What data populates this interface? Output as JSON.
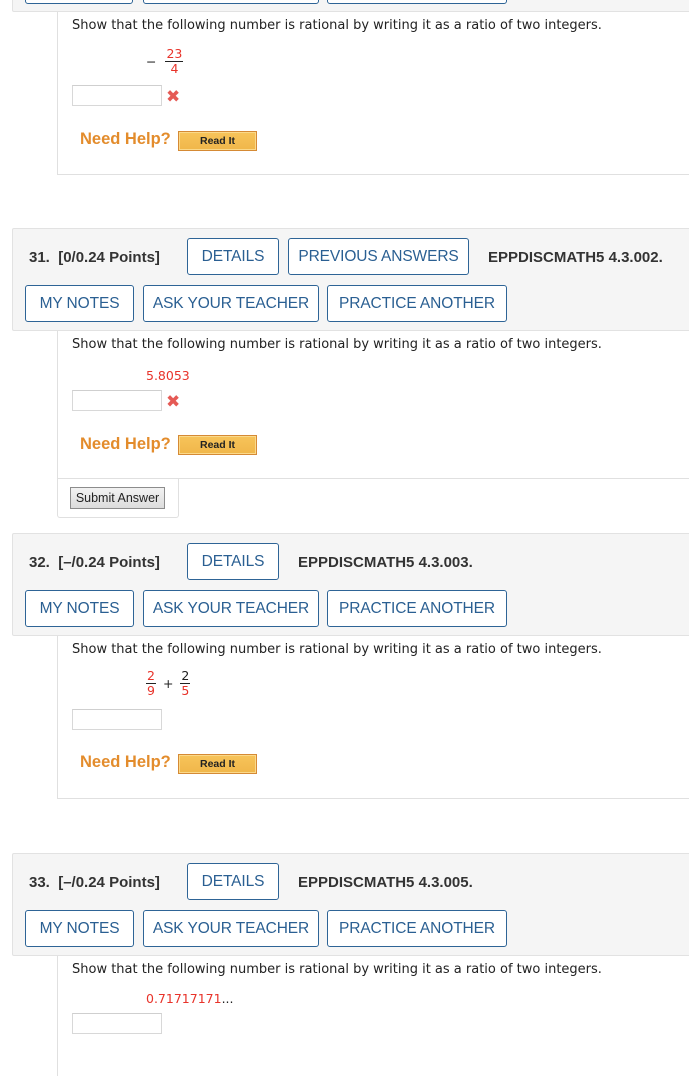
{
  "colors": {
    "accent_blue": "#2a5f92",
    "header_bg": "#f5f5f5",
    "math_red": "#e8332a",
    "need_help_orange": "#e38c2c",
    "read_it_bg": "#f0b64a",
    "incorrect_red": "#e55a55"
  },
  "common": {
    "prompt": "Show that the following number is rational by writing it as a ratio of two integers.",
    "need_help": "Need Help?",
    "read_it": "Read It",
    "submit_answer": "Submit Answer",
    "details": "DETAILS",
    "previous_answers": "PREVIOUS ANSWERS",
    "my_notes": "MY NOTES",
    "ask_your_teacher": "ASK YOUR TEACHER",
    "practice_another": "PRACTICE ANOTHER"
  },
  "questions": [
    {
      "number": "",
      "expression": {
        "sign": "−",
        "numerator": "23",
        "denominator": "4"
      },
      "answer_value": "",
      "status_icon": "incorrect-x-icon"
    },
    {
      "number": "31.",
      "points": "[0/0.24 Points]",
      "code": "EPPDISCMATH5 4.3.002.",
      "expression": {
        "value": "5.8053"
      },
      "answer_value": "",
      "status_icon": "incorrect-x-icon"
    },
    {
      "number": "32.",
      "points": "[–/0.24 Points]",
      "code": "EPPDISCMATH5 4.3.003.",
      "expression": {
        "a_num": "2",
        "a_den": "9",
        "op": "+",
        "b_num": "2",
        "b_den": "5"
      },
      "answer_value": ""
    },
    {
      "number": "33.",
      "points": "[–/0.24 Points]",
      "code": "EPPDISCMATH5 4.3.005.",
      "expression": {
        "value": "0.71717171",
        "ellipsis": "..."
      },
      "answer_value": ""
    }
  ]
}
